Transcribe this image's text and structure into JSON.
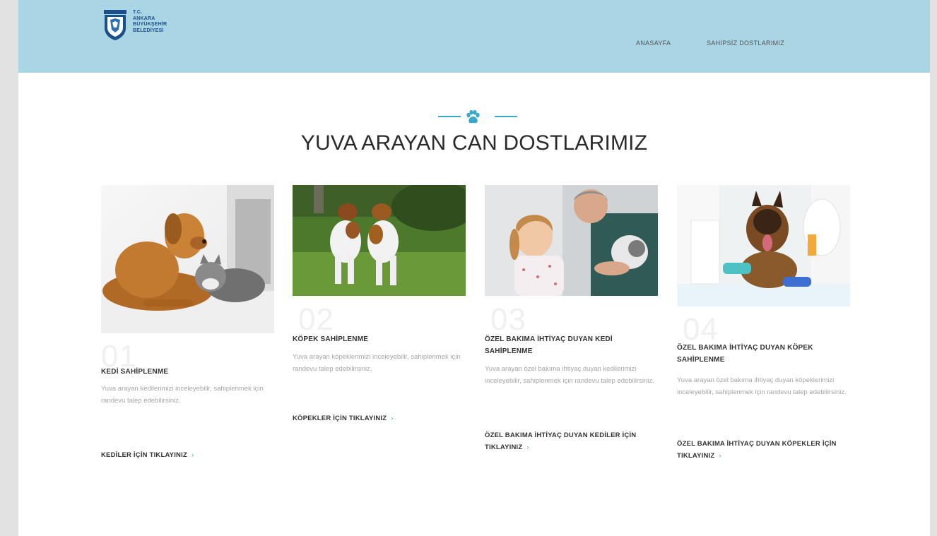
{
  "header": {
    "logo_lines": [
      "T.C.",
      "ANKARA",
      "BÜYÜKŞEHİR",
      "BELEDİYESİ"
    ],
    "nav": {
      "home": "ANASAYFA",
      "pets": "SAHİPSİZ DOSTLARIMIZ"
    }
  },
  "section": {
    "title": "YUVA ARAYAN CAN DOSTLARIMIZ",
    "icon": "paw-icon"
  },
  "cards": [
    {
      "number": "01",
      "title": "KEDİ SAHİPLENME",
      "description": "Yuva arayan kedilerimizi inceleyebilir, sahiplenmek için randevu talep edebilirsiniz.",
      "link": "KEDİLER İÇİN TIKLAYINIZ",
      "image": "dog-and-cat-photo"
    },
    {
      "number": "02",
      "title": "KÖPEK SAHİPLENME",
      "description": "Yuva arayan köpeklerimizi inceleyebilir, sahiplenmek için randevu talep edebilirsiniz.",
      "link": "KÖPEKLER İÇİN TIKLAYINIZ",
      "image": "two-dogs-playing-photo"
    },
    {
      "number": "03",
      "title": "ÖZEL BAKIMA İHTİYAÇ DUYAN KEDİ SAHİPLENME",
      "description": "Yuva arayan özel bakıma ihtiyaç duyan kedilerimizi inceleyebilir, sahiplenmek için randevu talep edebilirsiniz.",
      "link": "ÖZEL BAKIMA İHTİYAÇ DUYAN KEDİLER İÇİN TIKLAYINIZ",
      "image": "girl-with-kitten-photo"
    },
    {
      "number": "04",
      "title": "ÖZEL BAKIMA İHTİYAÇ DUYAN KÖPEK SAHİPLENME",
      "description": "Yuva arayan özel bakıma ihtiyaç duyan köpeklerimizi inceleyebilir, sahiplenmek için randevu talep edebilirsiniz.",
      "link": "ÖZEL BAKIMA İHTİYAÇ DUYAN KÖPEKLER İÇİN TIKLAYINIZ",
      "image": "dog-at-vet-photo"
    }
  ],
  "colors": {
    "header_bg": "#a9d5e5",
    "accent": "#3aa9c9",
    "text_dark": "#333333",
    "text_muted": "#a5a5a5"
  }
}
